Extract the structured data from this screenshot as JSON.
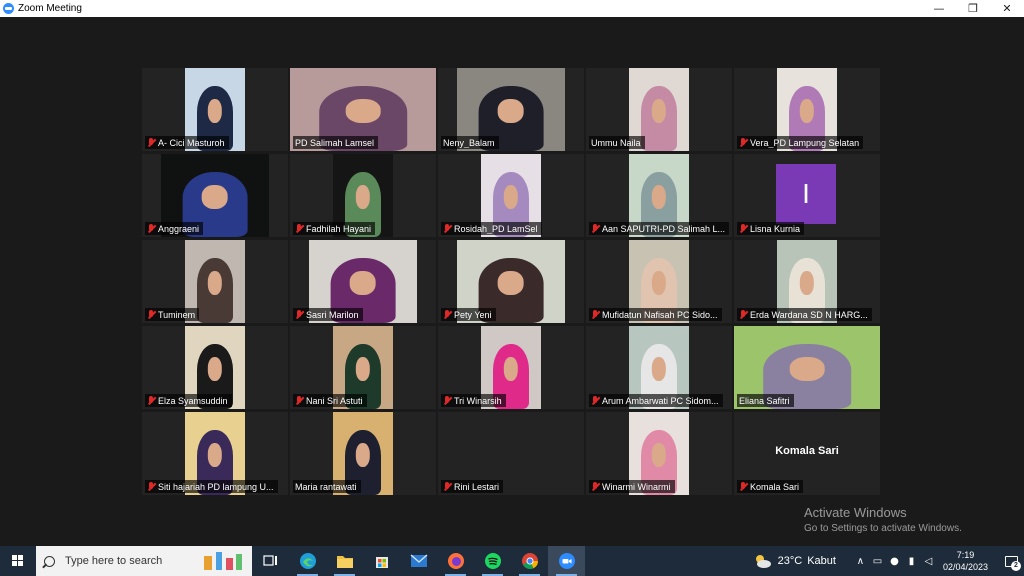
{
  "window": {
    "title": "Zoom Meeting",
    "minimize": "—",
    "restore": "❐",
    "close": "✕"
  },
  "participants": [
    {
      "name": "A- Cici Masturoh",
      "muted": true,
      "bg": "#c8d7e6",
      "hijab": "#1e2a45"
    },
    {
      "name": "PD Salimah Lamsel",
      "muted": false,
      "active": true,
      "bg": "#b79a9a",
      "hijab": "#6b4767"
    },
    {
      "name": "Neny_Balam",
      "muted": false,
      "bg": "#8a8680",
      "hijab": "#1f1f2a"
    },
    {
      "name": "Ummu Naila",
      "muted": false,
      "bg": "#e0d8d2",
      "hijab": "#c58aa4"
    },
    {
      "name": "Vera_PD Lampung Selatan",
      "muted": true,
      "bg": "#e8e2dc",
      "hijab": "#b07ab6"
    },
    {
      "name": "Anggraeni",
      "muted": true,
      "bg": "#0f1210",
      "hijab": "#2a3a8a"
    },
    {
      "name": "Fadhilah Hayani",
      "muted": true,
      "bg": "#151515",
      "hijab": "#5a8a5a"
    },
    {
      "name": "Rosidah_PD LamSel",
      "muted": true,
      "bg": "#e6e0e6",
      "hijab": "#a58ac0"
    },
    {
      "name": "Aan SAPUTRI-PD Salimah L...",
      "muted": true,
      "bg": "#c8d8c8",
      "hijab": "#8aa0a0"
    },
    {
      "name": "Lisna Kurnia",
      "muted": true,
      "initial": "I"
    },
    {
      "name": "Tuminem",
      "muted": true,
      "bg": "#c0b8b0",
      "hijab": "#4a3a36"
    },
    {
      "name": "Sasri Marilon",
      "muted": true,
      "bg": "#d6d2ce",
      "hijab": "#6a2a6a"
    },
    {
      "name": "Pety Yeni",
      "muted": true,
      "bg": "#cfd3c8",
      "hijab": "#3a2a2a"
    },
    {
      "name": "Mufidatun Nafisah PC Sido...",
      "muted": true,
      "bg": "#c8c2b2",
      "hijab": "#e0c4b0"
    },
    {
      "name": "Erda Wardana SD N HARG...",
      "muted": true,
      "bg": "#b8c4b8",
      "hijab": "#e8e2d6"
    },
    {
      "name": "Elza Syamsuddin",
      "muted": true,
      "bg": "#e0d6c0",
      "hijab": "#1a1a1a"
    },
    {
      "name": "Nani Sri Astuti",
      "muted": true,
      "bg": "#c8a884",
      "hijab": "#1e3a2a"
    },
    {
      "name": "Tri Winarsih",
      "muted": true,
      "bg": "#d0c8c4",
      "hijab": "#e02a8a"
    },
    {
      "name": "Arum Ambarwati PC Sidom...",
      "muted": true,
      "bg": "#b8c6c0",
      "hijab": "#e6e6e6"
    },
    {
      "name": "Eliana Safitri",
      "muted": false,
      "bg": "#9cc46a",
      "hijab": "#8a80a0"
    },
    {
      "name": "Siti hajariah PD lampung U...",
      "muted": true,
      "bg": "#e8d090",
      "hijab": "#3a2a5a"
    },
    {
      "name": "Maria rantawati",
      "muted": false,
      "bg": "#d8b070",
      "hijab": "#1e2030"
    },
    {
      "name": "Rini Lestari",
      "muted": true,
      "novideo": true
    },
    {
      "name": "Winarmi Winarmi",
      "muted": true,
      "bg": "#e8e0dc",
      "hijab": "#e08aa8"
    },
    {
      "name": "Komala Sari",
      "muted": true,
      "centername": "Komala Sari"
    }
  ],
  "watermark": {
    "title": "Activate Windows",
    "subtitle": "Go to Settings to activate Windows."
  },
  "taskbar": {
    "search_placeholder": "Type here to search",
    "weather_temp": "23°C",
    "weather_desc": "Kabut",
    "time": "7:19",
    "date": "02/04/2023",
    "notification_count": "2"
  }
}
